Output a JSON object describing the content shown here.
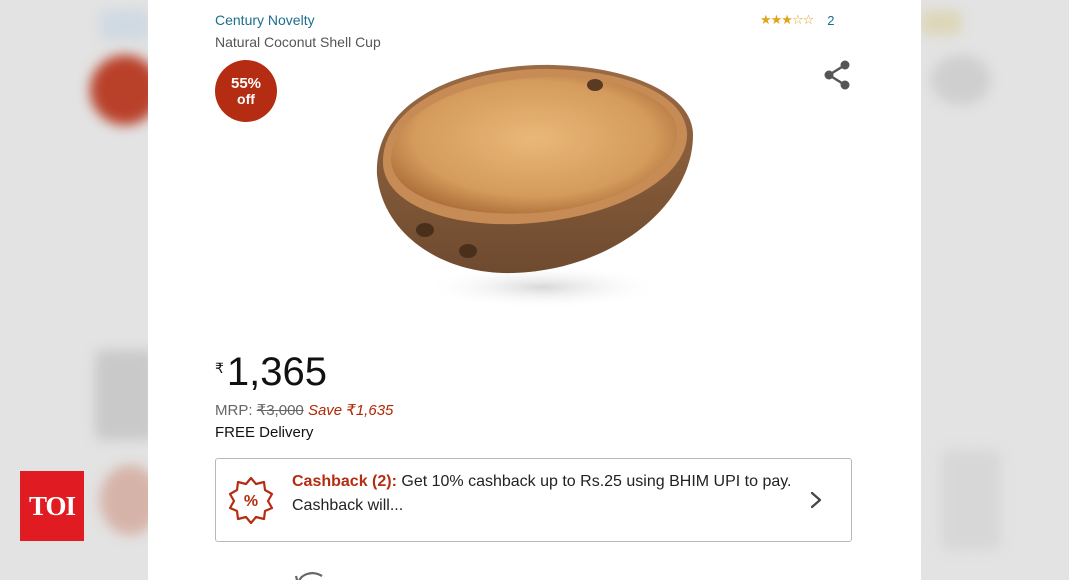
{
  "product": {
    "brand": "Century Novelty",
    "title": "Natural Coconut Shell Cup",
    "rating_stars": "★★★☆☆",
    "rating_value": 3,
    "rating_count": "2",
    "discount": {
      "percent": "55%",
      "label": "off"
    },
    "image_icon": "coconut-shell-cup-image"
  },
  "price": {
    "currency": "₹",
    "amount": "1,365",
    "mrp_label": "MRP:",
    "mrp_value": "₹3,000",
    "save_text": "Save ₹1,635",
    "delivery": "FREE Delivery"
  },
  "cashback": {
    "label": "Cashback (2):",
    "text": "Get 10% cashback up to Rs.25 using BHIM UPI to pay. Cashback will...",
    "icon": "percent-badge-icon"
  },
  "watermark": {
    "text": "TOI"
  },
  "colors": {
    "brand_link": "#1a6f8c",
    "badge": "#b42d12",
    "save": "#b12704",
    "star": "#e3a21a",
    "watermark": "#e11b22"
  }
}
